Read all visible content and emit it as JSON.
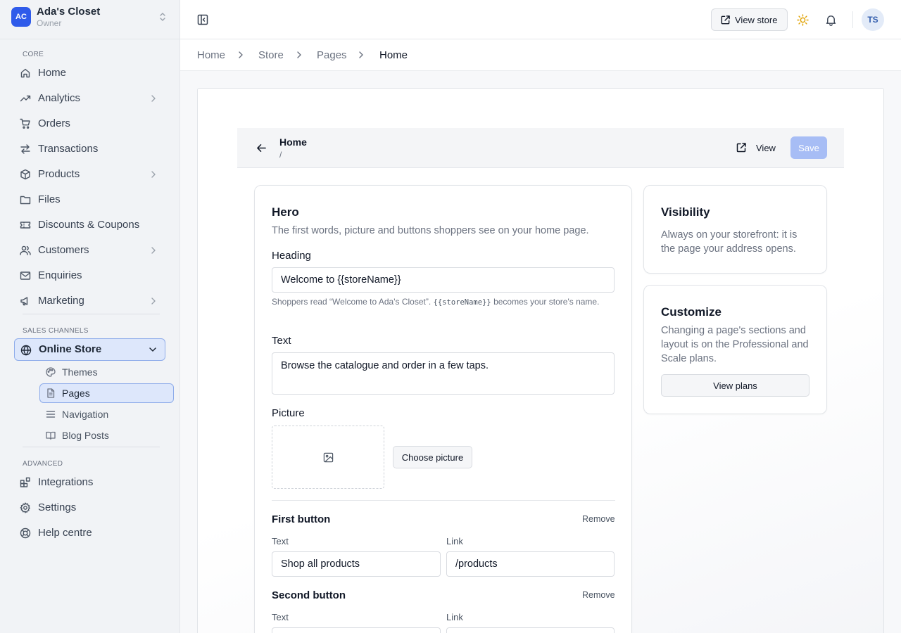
{
  "brand": {
    "initials": "AC",
    "name": "Ada's Closet",
    "role": "Owner"
  },
  "sidebar": {
    "section_core": "CORE",
    "section_sales": "SALES CHANNELS",
    "section_advanced": "ADVANCED",
    "core_items": [
      {
        "label": "Home",
        "icon": "home-icon"
      },
      {
        "label": "Analytics",
        "icon": "trend-up-icon",
        "has_children": true
      },
      {
        "label": "Orders",
        "icon": "cart-icon"
      },
      {
        "label": "Transactions",
        "icon": "arrows-exchange-icon"
      },
      {
        "label": "Products",
        "icon": "box-icon",
        "has_children": true
      },
      {
        "label": "Files",
        "icon": "folder-icon"
      },
      {
        "label": "Discounts & Coupons",
        "icon": "ticket-icon"
      },
      {
        "label": "Customers",
        "icon": "users-icon",
        "has_children": true
      },
      {
        "label": "Enquiries",
        "icon": "mail-icon"
      },
      {
        "label": "Marketing",
        "icon": "megaphone-icon",
        "has_children": true
      }
    ],
    "sales_item": {
      "label": "Online Store",
      "icon": "globe-icon",
      "expanded": true
    },
    "sales_subitems": [
      {
        "label": "Themes",
        "icon": "palette-icon"
      },
      {
        "label": "Pages",
        "icon": "file-text-icon",
        "active": true
      },
      {
        "label": "Navigation",
        "icon": "menu-lines-icon"
      },
      {
        "label": "Blog Posts",
        "icon": "book-open-icon"
      }
    ],
    "advanced_items": [
      {
        "label": "Integrations",
        "icon": "blocks-icon"
      },
      {
        "label": "Settings",
        "icon": "gear-icon"
      },
      {
        "label": "Help centre",
        "icon": "lifebuoy-icon"
      }
    ]
  },
  "topbar": {
    "view_store_label": "View store",
    "avatar_initials": "TS"
  },
  "breadcrumbs": [
    "Home",
    "Store",
    "Pages",
    "Home"
  ],
  "page": {
    "title": "Home",
    "path": "/",
    "view_label": "View",
    "save_label": "Save"
  },
  "hero": {
    "title": "Hero",
    "description": "The first words, picture and buttons shoppers see on your home page.",
    "heading_label": "Heading",
    "heading_value": "Welcome to {{storeName}}",
    "heading_hint_prefix": "Shoppers read “Welcome to Ada's Closet”.",
    "heading_hint_code": "{{storeName}}",
    "heading_hint_suffix": "becomes your store's name.",
    "text_label": "Text",
    "text_value": "Browse the catalogue and order in a few taps.",
    "picture_label": "Picture",
    "choose_picture_label": "Choose picture",
    "first_button": {
      "title": "First button",
      "remove_label": "Remove",
      "text_label": "Text",
      "text_value": "Shop all products",
      "link_label": "Link",
      "link_value": "/products"
    },
    "second_button": {
      "title": "Second button",
      "remove_label": "Remove",
      "text_label": "Text",
      "link_label": "Link"
    }
  },
  "visibility": {
    "title": "Visibility",
    "description": "Always on your storefront: it is the page your address opens."
  },
  "customize": {
    "title": "Customize",
    "description": "Changing a page's sections and layout is on the Professional and Scale plans.",
    "button_label": "View plans"
  },
  "colors": {
    "accent": "#2f5bea",
    "active_nav_bg": "#dde7fb",
    "active_nav_border": "#8eacea",
    "save_disabled": "#a7bdf5",
    "sun": "#e0a100"
  }
}
